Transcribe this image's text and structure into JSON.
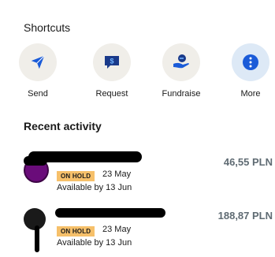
{
  "shortcuts": {
    "title": "Shortcuts",
    "items": [
      {
        "label": "Send",
        "icon": "send-icon"
      },
      {
        "label": "Request",
        "icon": "request-icon"
      },
      {
        "label": "Fundraise",
        "icon": "fundraise-icon"
      },
      {
        "label": "More",
        "icon": "more-icon"
      }
    ]
  },
  "recent": {
    "title": "Recent activity",
    "items": [
      {
        "status": "ON HOLD",
        "date": "23 May",
        "available": "Available by 13 Jun",
        "amount": "46,55 PLN"
      },
      {
        "status": "ON HOLD",
        "date": "23 May",
        "available": "Available by 13 Jun",
        "amount": "188,87 PLN"
      }
    ]
  },
  "colors": {
    "accent": "#1a5bd8",
    "badge": "#f6c06a",
    "amount": "#5f6b73",
    "icon_bg": "#f0eee9"
  }
}
